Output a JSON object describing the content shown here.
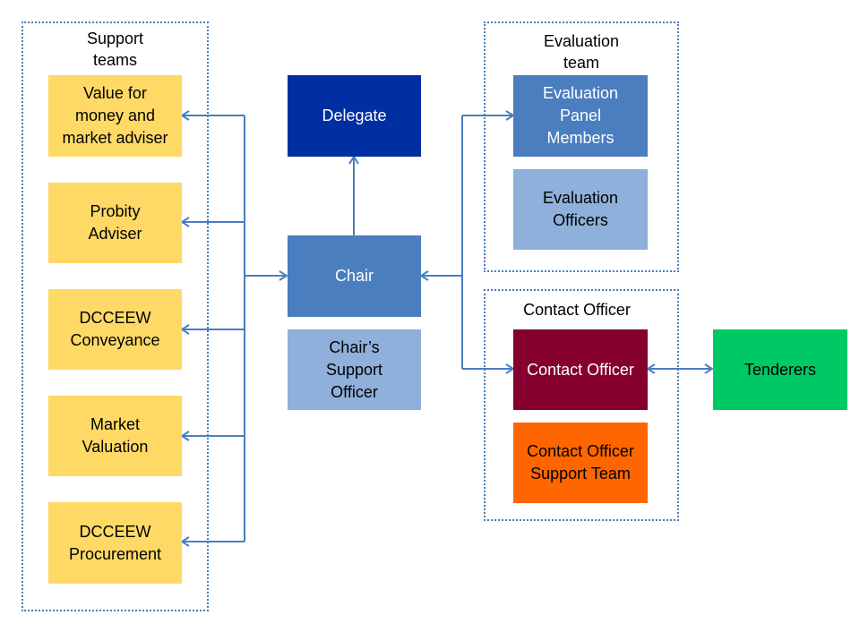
{
  "diagram": {
    "groups": {
      "support": {
        "title": "Support\nteams",
        "lines": [
          "Support",
          "teams"
        ]
      },
      "evaluation": {
        "title": "Evaluation team",
        "lines": [
          "Evaluation",
          "team"
        ]
      },
      "contact": {
        "title": "Contact Officer",
        "lines": [
          "Contact Officer"
        ]
      }
    },
    "nodes": {
      "value_for_money": {
        "lines": [
          "Value for",
          "money and",
          "market adviser"
        ],
        "color": "#FFD966"
      },
      "probity": {
        "lines": [
          "Probity",
          "Adviser"
        ],
        "color": "#FFD966"
      },
      "conveyance": {
        "lines": [
          "DCCEEW",
          "Conveyance"
        ],
        "color": "#FFD966"
      },
      "market_valuation": {
        "lines": [
          "Market",
          "Valuation"
        ],
        "color": "#FFD966"
      },
      "procurement": {
        "lines": [
          "DCCEEW",
          "Procurement"
        ],
        "color": "#FFD966"
      },
      "delegate": {
        "lines": [
          "Delegate"
        ],
        "color": "#002EA3"
      },
      "chair": {
        "lines": [
          "Chair"
        ],
        "color": "#4A7EBF"
      },
      "chair_support": {
        "lines": [
          "Chair’s",
          "Support",
          "Officer"
        ],
        "color": "#8EB0DA"
      },
      "eval_panel": {
        "lines": [
          "Evaluation",
          "Panel",
          "Members"
        ],
        "color": "#4A7EBF"
      },
      "eval_officers": {
        "lines": [
          "Evaluation",
          "Officers"
        ],
        "color": "#8EB0DA"
      },
      "contact_officer": {
        "lines": [
          "Contact Officer"
        ],
        "color": "#85002F"
      },
      "contact_support": {
        "lines": [
          "Contact Officer",
          "Support Team"
        ],
        "color": "#FF6600"
      },
      "tenderers": {
        "lines": [
          "Tenderers"
        ],
        "color": "#00C864"
      }
    },
    "connections": [
      {
        "from": "chair",
        "to": "delegate",
        "type": "arrow"
      },
      {
        "from": "support-trunk",
        "to": "value_for_money",
        "type": "arrow"
      },
      {
        "from": "support-trunk",
        "to": "probity",
        "type": "arrow"
      },
      {
        "from": "support-trunk",
        "to": "conveyance",
        "type": "arrow"
      },
      {
        "from": "support-trunk",
        "to": "market_valuation",
        "type": "arrow"
      },
      {
        "from": "support-trunk",
        "to": "procurement",
        "type": "arrow"
      },
      {
        "from": "support-trunk",
        "to": "chair",
        "type": "arrow"
      },
      {
        "from": "right-trunk",
        "to": "chair",
        "type": "arrow"
      },
      {
        "from": "right-trunk",
        "to": "eval_panel",
        "type": "arrow"
      },
      {
        "from": "right-trunk",
        "to": "contact_officer",
        "type": "arrow"
      },
      {
        "from": "contact_officer",
        "to": "tenderers",
        "type": "bidirectional"
      }
    ],
    "line_color": "#4A7EBF",
    "text_dark": "#000000",
    "text_light": "#FFFFFF"
  }
}
